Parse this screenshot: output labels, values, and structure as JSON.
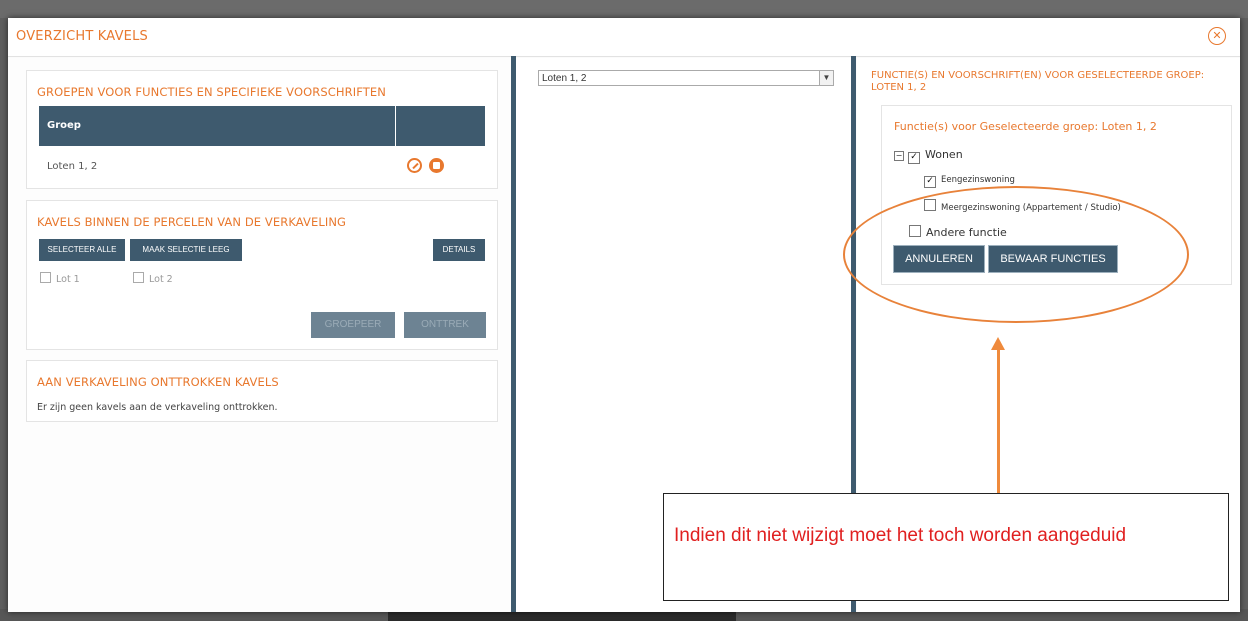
{
  "modal": {
    "title": "OVERZICHT KAVELS",
    "close_icon": "close-circle-icon"
  },
  "groups": {
    "title": "GROEPEN VOOR FUNCTIES EN SPECIFIEKE VOORSCHRIFTEN",
    "column_header": "Groep",
    "rows": [
      {
        "name": "Loten 1, 2",
        "edit_icon": "edit-icon",
        "delete_icon": "delete-icon"
      }
    ]
  },
  "kavels": {
    "title": "KAVELS BINNEN DE PERCELEN VAN DE VERKAVELING",
    "select_all_label": "SELECTEER ALLE",
    "clear_selection_label": "MAAK SELECTIE LEEG",
    "details_label": "DETAILS",
    "lots": [
      "Lot 1",
      "Lot 2"
    ],
    "group_label": "GROEPEER",
    "withdraw_label": "ONTTREK"
  },
  "withdrawn": {
    "title": "AAN VERKAVELING ONTTROKKEN KAVELS",
    "empty_text": "Er zijn geen kavels aan de verkaveling onttrokken."
  },
  "middle": {
    "select_value": "Loten 1, 2"
  },
  "right": {
    "title": "FUNCTIE(S) EN VOORSCHRIFT(EN) VOOR GESELECTEERDE GROEP: LOTEN 1, 2",
    "subtitle": "Functie(s) voor Geselecteerde groep: Loten 1, 2",
    "tree": {
      "wonen": {
        "label": "Wonen",
        "checked": true
      },
      "eengezins": {
        "label": "Eengezinswoning",
        "checked": true
      },
      "meergezins": {
        "label": "Meergezinswoning (Appartement / Studio)",
        "checked": false
      },
      "andere": {
        "label": "Andere functie",
        "checked": false
      }
    },
    "cancel_label": "ANNULEREN",
    "save_label": "BEWAAR FUNCTIES"
  },
  "annotation": {
    "note": "Indien dit niet wijzigt moet het toch worden aangeduid",
    "highlight_color": "#e8823a",
    "note_color": "#e02020"
  },
  "colors": {
    "accent": "#e8782e",
    "header_bg": "#3e5a6e"
  }
}
